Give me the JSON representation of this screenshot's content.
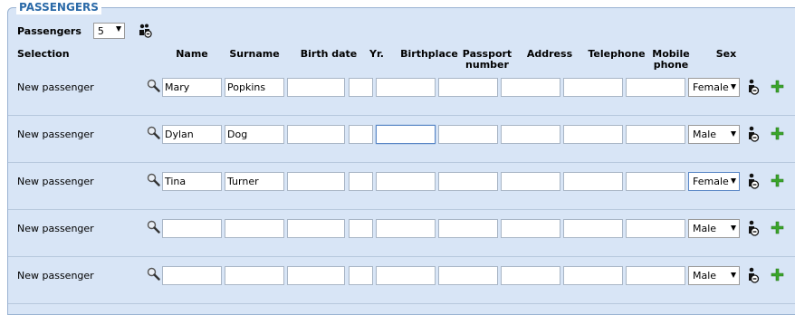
{
  "section_title": "PASSENGERS",
  "passengers_label": "Passengers",
  "passengers_count": "5",
  "columns": {
    "selection": "Selection",
    "name": "Name",
    "surname": "Surname",
    "birth_date": "Birth date",
    "yr": "Yr.",
    "birthplace": "Birthplace",
    "passport_l1": "Passport",
    "passport_l2": "number",
    "address": "Address",
    "telephone": "Telephone",
    "mobile_l1": "Mobile",
    "mobile_l2": "phone",
    "sex": "Sex"
  },
  "rows": [
    {
      "selection": "New passenger",
      "name": "Mary",
      "surname": "Popkins",
      "birth_date": "",
      "yr": "",
      "birthplace": "",
      "passport": "",
      "address": "",
      "telephone": "",
      "mobile": "",
      "sex": "Female"
    },
    {
      "selection": "New passenger",
      "name": "Dylan",
      "surname": "Dog",
      "birth_date": "",
      "yr": "",
      "birthplace": "",
      "passport": "",
      "address": "",
      "telephone": "",
      "mobile": "",
      "sex": "Male"
    },
    {
      "selection": "New passenger",
      "name": "Tina",
      "surname": "Turner",
      "birth_date": "",
      "yr": "",
      "birthplace": "",
      "passport": "",
      "address": "",
      "telephone": "",
      "mobile": "",
      "sex": "Female"
    },
    {
      "selection": "New passenger",
      "name": "",
      "surname": "",
      "birth_date": "",
      "yr": "",
      "birthplace": "",
      "passport": "",
      "address": "",
      "telephone": "",
      "mobile": "",
      "sex": "Male"
    },
    {
      "selection": "New passenger",
      "name": "",
      "surname": "",
      "birth_date": "",
      "yr": "",
      "birthplace": "",
      "passport": "",
      "address": "",
      "telephone": "",
      "mobile": "",
      "sex": "Male"
    }
  ],
  "icons": {
    "group": "passenger-group-icon",
    "search": "magnifier-icon",
    "person": "passenger-person-icon",
    "add": "green-plus-icon"
  },
  "colors": {
    "panel_bg": "#d8e5f6",
    "title": "#2b6aa8",
    "add_green": "#3aa52a"
  }
}
